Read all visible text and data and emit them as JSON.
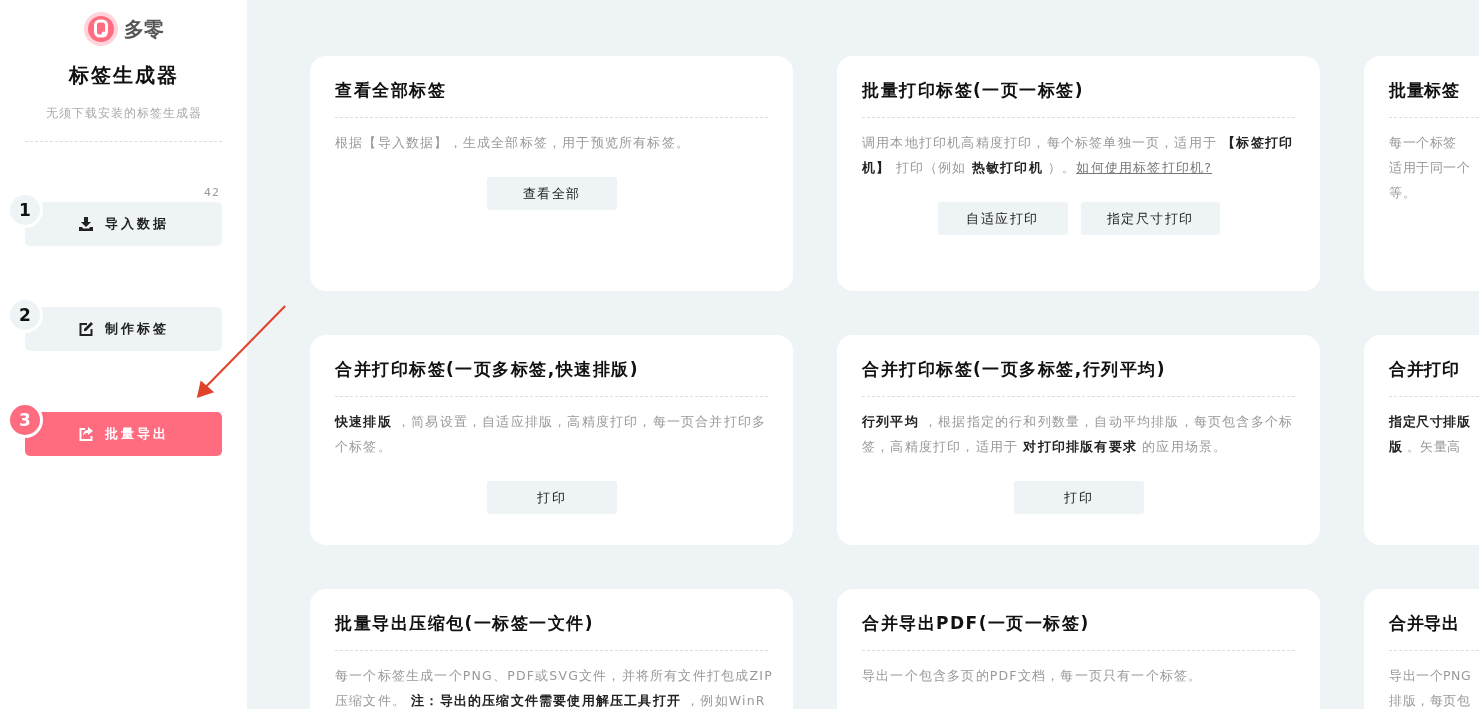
{
  "sidebar": {
    "logo_text": "多零",
    "title": "标签生成器",
    "subtitle": "无须下载安装的标签生成器",
    "count": "42",
    "steps": [
      {
        "number": "1",
        "label": "导入数据",
        "kind": "import",
        "selected": false
      },
      {
        "number": "2",
        "label": "制作标签",
        "kind": "edit",
        "selected": false
      },
      {
        "number": "3",
        "label": "批量导出",
        "kind": "export",
        "selected": true
      }
    ]
  },
  "cards": [
    {
      "title": "查看全部标签",
      "clipped": false,
      "lines": [
        [
          {
            "kind": "plain",
            "text": "根据【导入数据】，生成全部标签，用于预览所有标签。"
          }
        ]
      ],
      "buttons": [
        "查看全部"
      ]
    },
    {
      "title": "批量打印标签(一页一标签)",
      "clipped": false,
      "lines": [
        [
          {
            "kind": "plain",
            "text": "调用本地打印机高精度打印，每个标签单独一页，适用于 "
          },
          {
            "kind": "bold",
            "text": "【标签打印"
          }
        ],
        [
          {
            "kind": "bold",
            "text": "机】"
          },
          {
            "kind": "plain",
            "text": " 打印（例如 "
          },
          {
            "kind": "bold",
            "text": "热敏打印机"
          },
          {
            "kind": "plain",
            "text": " ）。"
          },
          {
            "kind": "link",
            "text": "如何使用标签打印机?"
          }
        ]
      ],
      "buttons": [
        "自适应打印",
        "指定尺寸打印"
      ]
    },
    {
      "title": "批量标签",
      "clipped": true,
      "lines": [
        [
          {
            "kind": "plain",
            "text": "每一个标签"
          }
        ],
        [
          {
            "kind": "plain",
            "text": "适用于同一个"
          }
        ],
        [
          {
            "kind": "plain",
            "text": "等。"
          }
        ]
      ]
    },
    {
      "title": "合并打印标签(一页多标签,快速排版)",
      "clipped": false,
      "lines": [
        [
          {
            "kind": "bold",
            "text": "快速排版"
          },
          {
            "kind": "plain",
            "text": " ，简易设置，自适应排版，高精度打印，每一页合并打印多"
          }
        ],
        [
          {
            "kind": "plain",
            "text": "个标签。"
          }
        ]
      ],
      "buttons": [
        "打印"
      ]
    },
    {
      "title": "合并打印标签(一页多标签,行列平均)",
      "clipped": false,
      "lines": [
        [
          {
            "kind": "bold",
            "text": "行列平均"
          },
          {
            "kind": "plain",
            "text": " ，根据指定的行和列数量，自动平均排版，每页包含多个标"
          }
        ],
        [
          {
            "kind": "plain",
            "text": "签，高精度打印，适用于 "
          },
          {
            "kind": "bold",
            "text": "对打印排版有要求"
          },
          {
            "kind": "plain",
            "text": " 的应用场景。"
          }
        ]
      ],
      "buttons": [
        "打印"
      ]
    },
    {
      "title": "合并打印",
      "clipped": true,
      "lines": [
        [
          {
            "kind": "bold",
            "text": "指定尺寸排版"
          }
        ],
        [
          {
            "kind": "bold",
            "text": "版"
          },
          {
            "kind": "plain",
            "text": " 。矢量高"
          }
        ]
      ]
    },
    {
      "title": "批量导出压缩包(一标签一文件)",
      "clipped": false,
      "lines": [
        [
          {
            "kind": "plain",
            "text": "每一个标签生成一个PNG、PDF或SVG文件，并将所有文件打包成ZIP"
          }
        ],
        [
          {
            "kind": "plain",
            "text": "压缩文件。 "
          },
          {
            "kind": "bold",
            "text": "注：导出的压缩文件需要使用解压工具打开"
          },
          {
            "kind": "plain",
            "text": " ，例如WinR"
          }
        ]
      ]
    },
    {
      "title": "合并导出PDF(一页一标签)",
      "clipped": false,
      "lines": [
        [
          {
            "kind": "plain",
            "text": "导出一个包含多页的PDF文档，每一页只有一个标签。"
          }
        ]
      ]
    },
    {
      "title": "合并导出",
      "clipped": true,
      "lines": [
        [
          {
            "kind": "plain",
            "text": "导出一个PNG"
          }
        ],
        [
          {
            "kind": "plain",
            "text": "排版，每页包"
          }
        ]
      ]
    }
  ]
}
